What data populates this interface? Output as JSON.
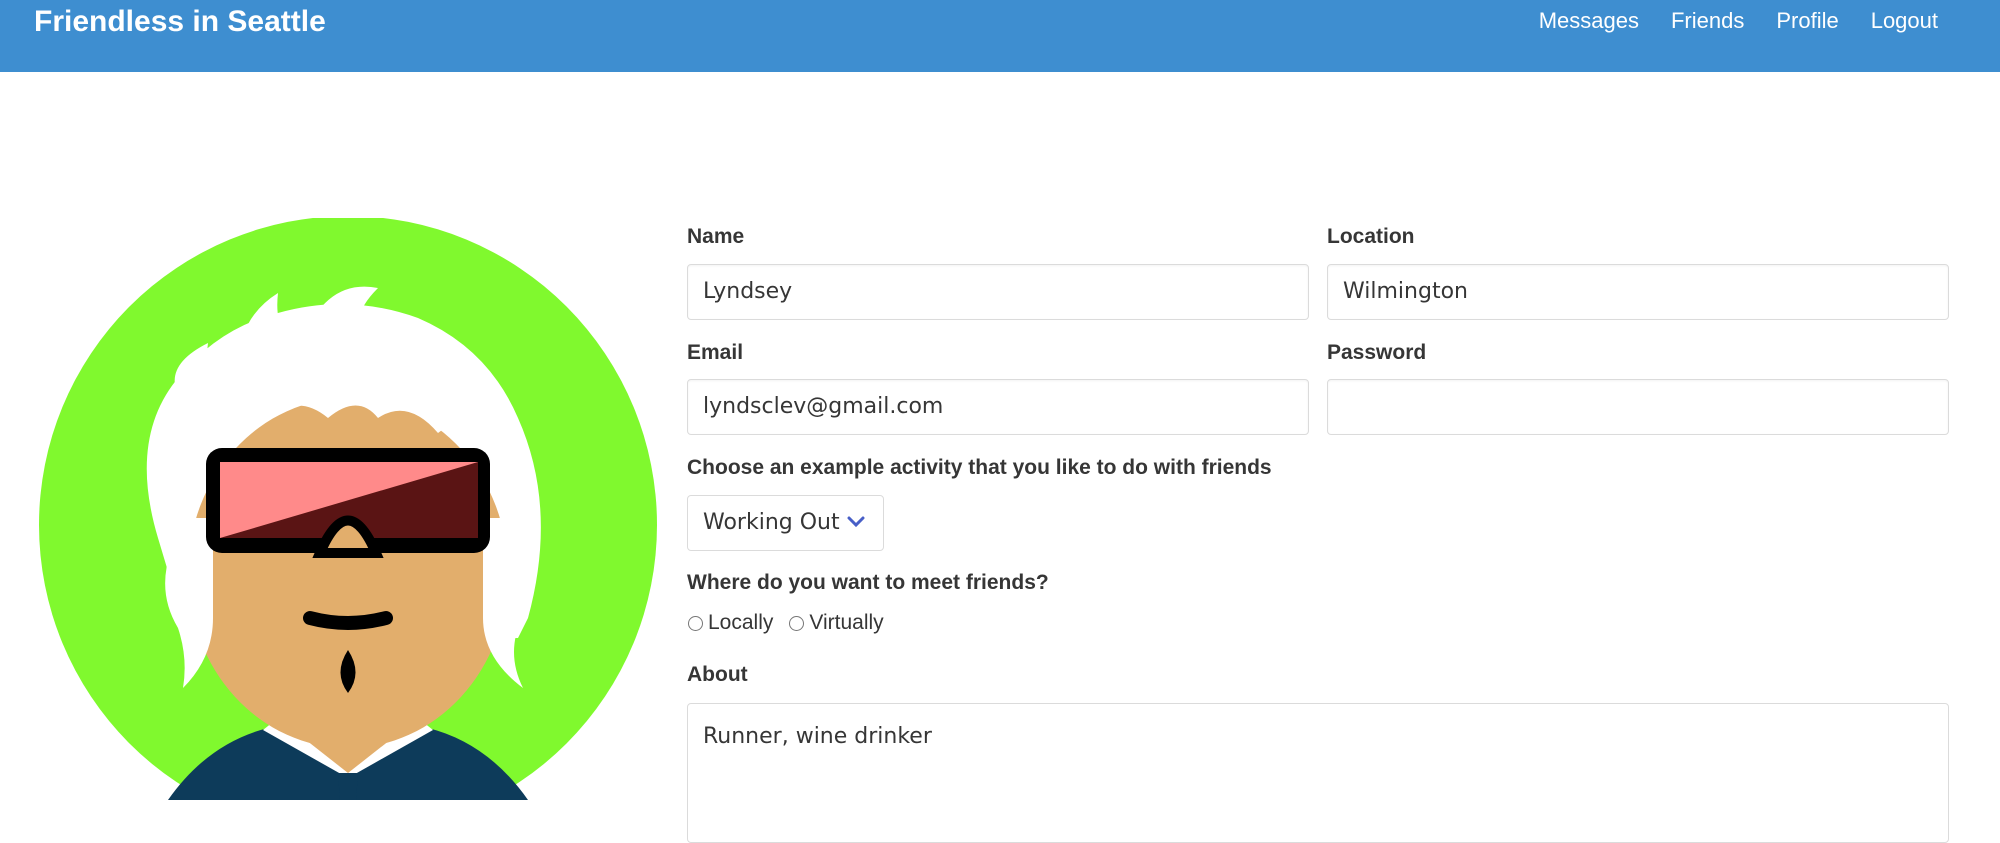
{
  "navbar": {
    "brand": "Friendless in Seattle",
    "links": [
      "Messages",
      "Friends",
      "Profile",
      "Logout"
    ],
    "color": "#3e8ed0"
  },
  "avatar": {
    "background_color": "#80f92e",
    "icon": "avatar-illustration"
  },
  "form": {
    "name": {
      "label": "Name",
      "value": "Lyndsey"
    },
    "location": {
      "label": "Location",
      "value": "Wilmington"
    },
    "email": {
      "label": "Email",
      "value": "lyndsclev@gmail.com"
    },
    "password": {
      "label": "Password",
      "value": ""
    },
    "activity": {
      "label": "Choose an example activity that you like to do with friends",
      "selected": "Working Out"
    },
    "meet": {
      "label": "Where do you want to meet friends?",
      "options": [
        "Locally",
        "Virtually"
      ]
    },
    "about": {
      "label": "About",
      "value": "Runner, wine drinker"
    }
  }
}
